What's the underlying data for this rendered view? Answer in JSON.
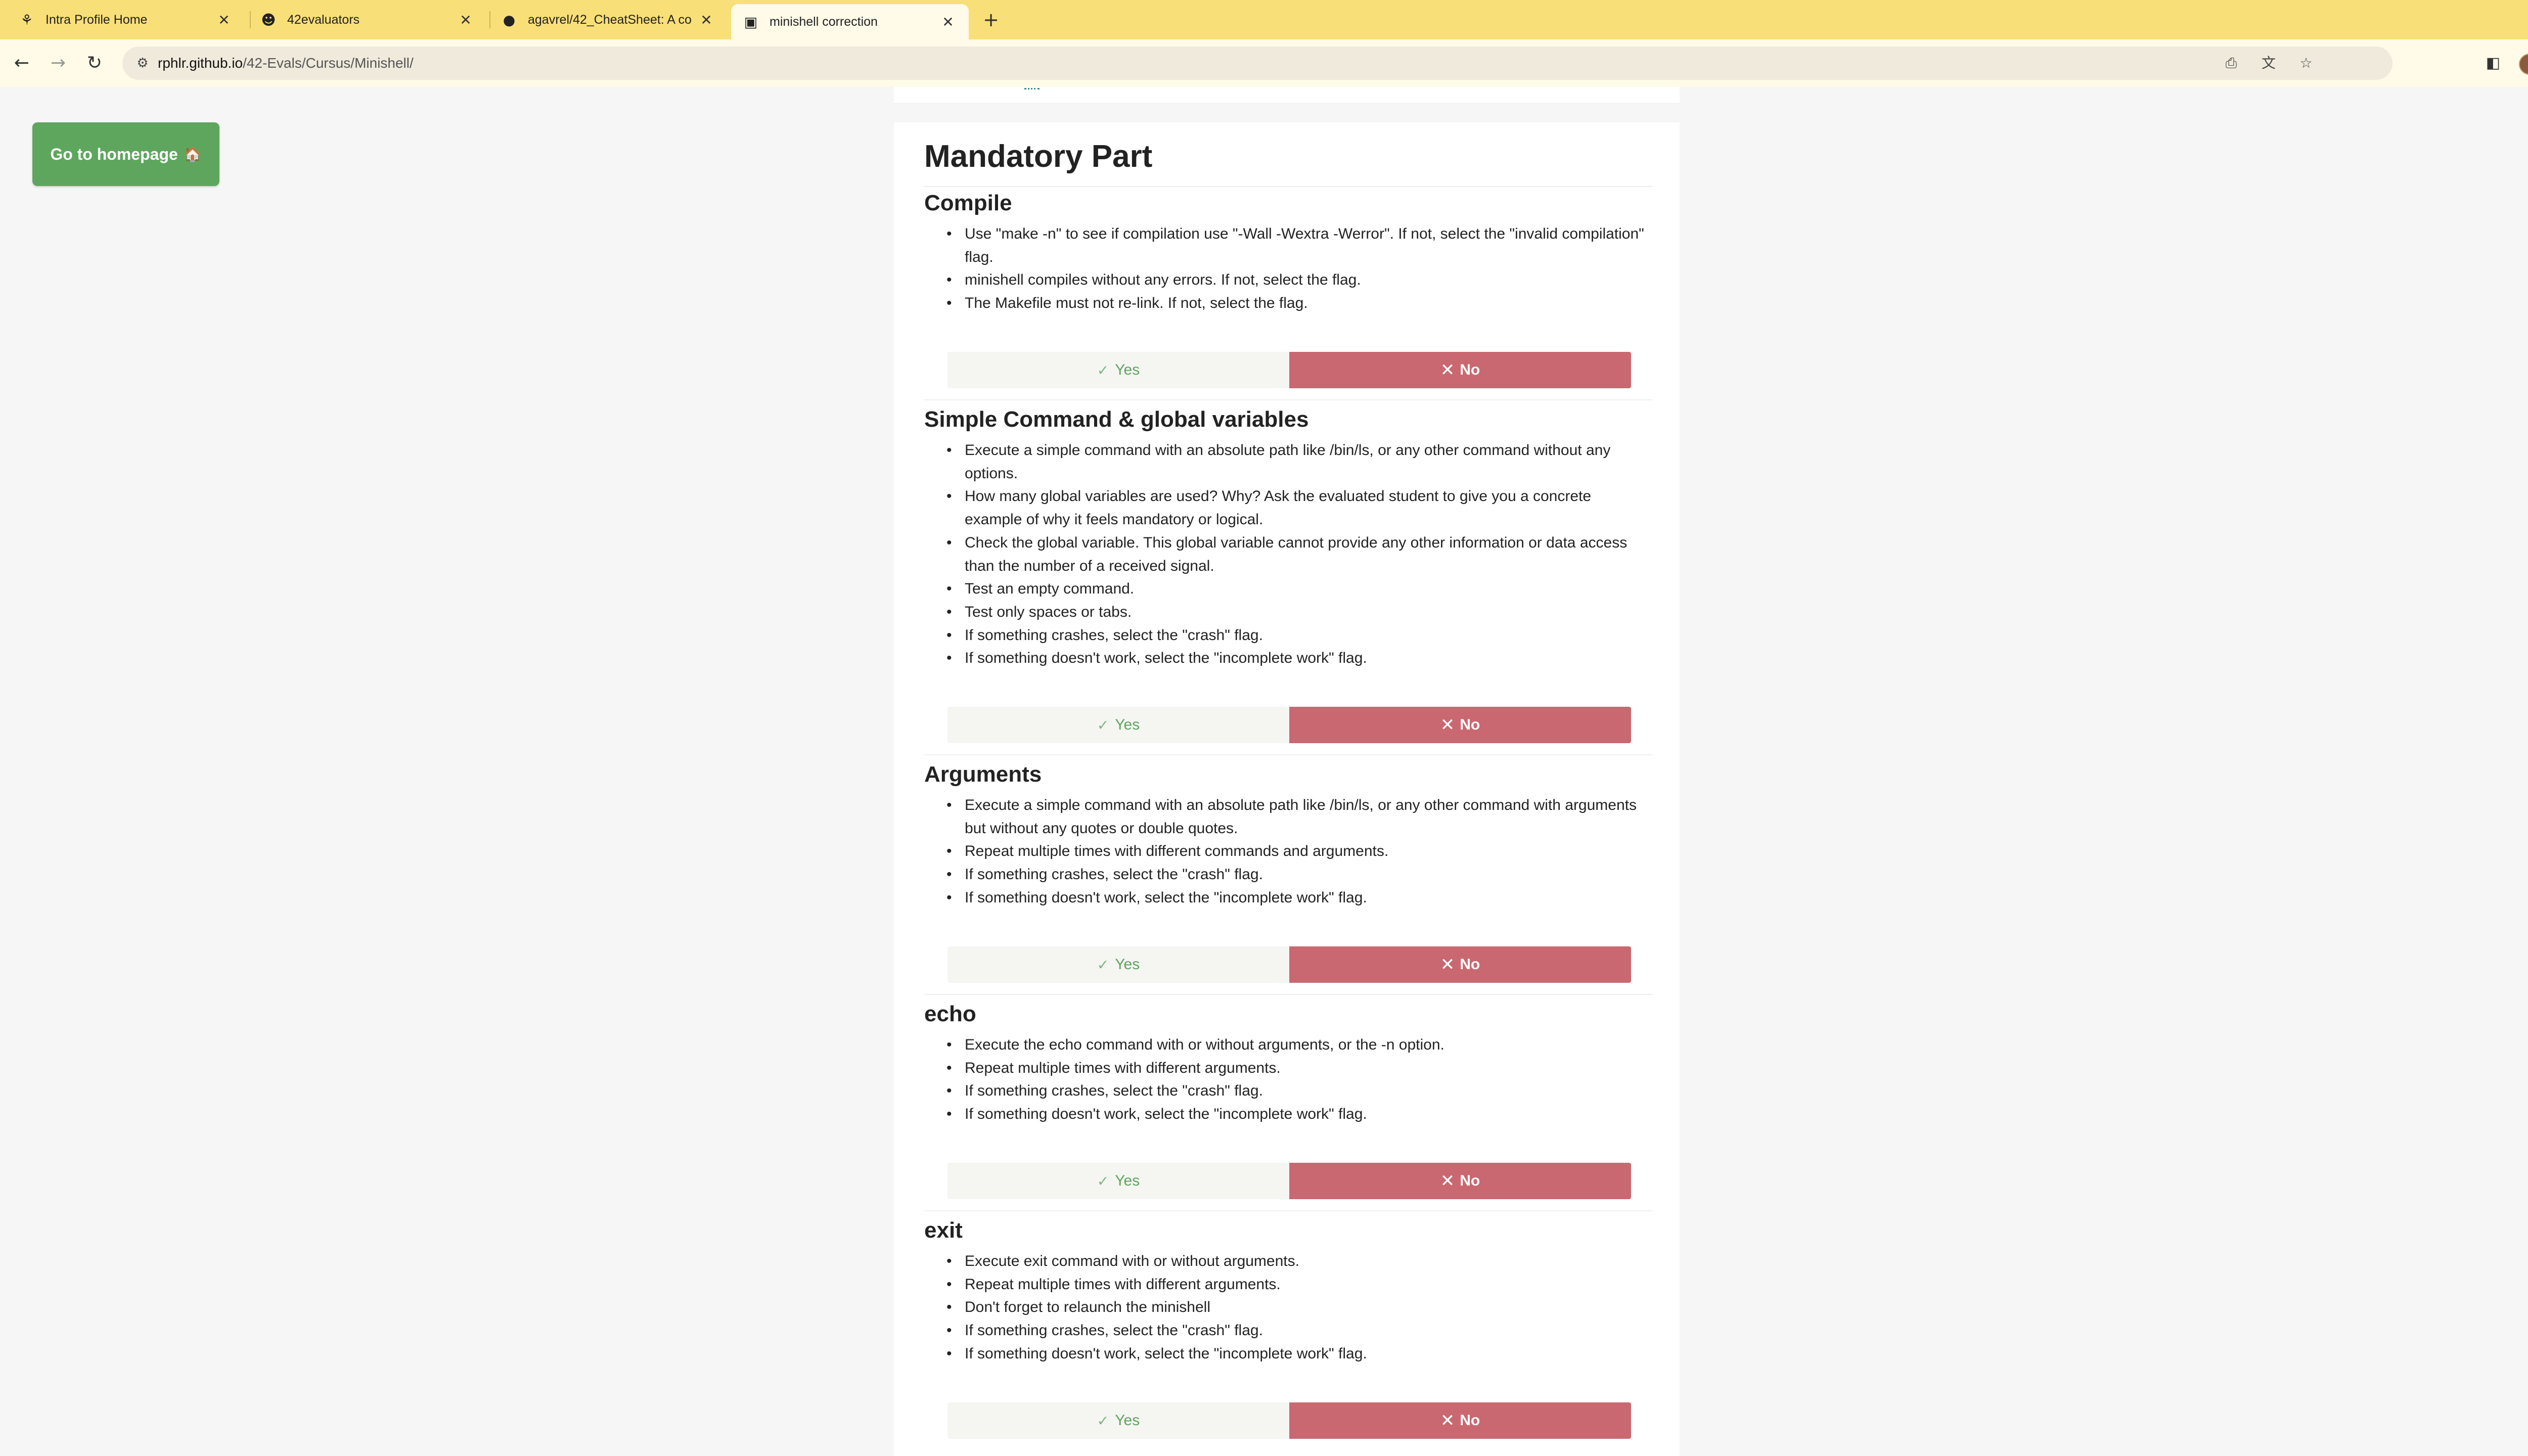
{
  "browser": {
    "tabs": [
      {
        "title": "Intra Profile Home",
        "favicon": "42-logo-icon",
        "active": false
      },
      {
        "title": "42evaluators",
        "favicon": "user-avatar-icon",
        "active": false
      },
      {
        "title": "agavrel/42_CheatSheet: A co",
        "favicon": "github-icon",
        "active": false
      },
      {
        "title": "minishell correction",
        "favicon": "site-icon",
        "active": true
      }
    ],
    "new_tab_glyph": "+",
    "url_domain": "rphlr.github.io",
    "url_path": "/42-Evals/Cursus/Minishell/"
  },
  "page": {
    "home_button_label": "Go to homepage",
    "home_icon": "🏠",
    "title": "Mandatory Part",
    "yes_label": "Yes",
    "no_label": "No",
    "colors": {
      "yes": "#5ea65e",
      "no": "#c96870",
      "home": "#5ea65e",
      "tabbar": "#f9df77"
    },
    "sections": [
      {
        "heading": "Compile",
        "items": [
          "Use \"make -n\" to see if compilation use \"-Wall -Wextra -Werror\". If not, select the \"invalid compilation\" flag.",
          "minishell compiles without any errors. If not, select the flag.",
          "The Makefile must not re-link. If not, select the flag."
        ]
      },
      {
        "heading": "Simple Command & global variables",
        "items": [
          "Execute a simple command with an absolute path like /bin/ls, or any other command without any options.",
          "How many global variables are used? Why? Ask the evaluated student to give you a concrete example of why it feels mandatory or logical.",
          "Check the global variable. This global variable cannot provide any other information or data access than the number of a received signal.",
          "Test an empty command.",
          "Test only spaces or tabs.",
          "If something crashes, select the \"crash\" flag.",
          "If something doesn't work, select the \"incomplete work\" flag."
        ]
      },
      {
        "heading": "Arguments",
        "items": [
          "Execute a simple command with an absolute path like /bin/ls, or any other command with arguments but without any quotes or double quotes.",
          "Repeat multiple times with different commands and arguments.",
          "If something crashes, select the \"crash\" flag.",
          "If something doesn't work, select the \"incomplete work\" flag."
        ]
      },
      {
        "heading": "echo",
        "items": [
          "Execute the echo command with or without arguments, or the -n option.",
          "Repeat multiple times with different arguments.",
          "If something crashes, select the \"crash\" flag.",
          "If something doesn't work, select the \"incomplete work\" flag."
        ]
      },
      {
        "heading": "exit",
        "items": [
          "Execute exit command with or without arguments.",
          "Repeat multiple times with different arguments.",
          "Don't forget to relaunch the minishell",
          "If something crashes, select the \"crash\" flag.",
          "If something doesn't work, select the \"incomplete work\" flag."
        ]
      }
    ]
  }
}
